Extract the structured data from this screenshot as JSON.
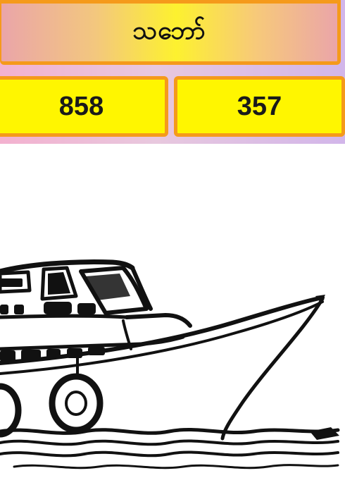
{
  "header": {
    "title": "သဘော်"
  },
  "numbers": {
    "left": "858",
    "right": "357"
  },
  "illustration": {
    "icon": "boat-illustration"
  },
  "colors": {
    "border": "#f59a1b",
    "number_box": "#fff600"
  }
}
